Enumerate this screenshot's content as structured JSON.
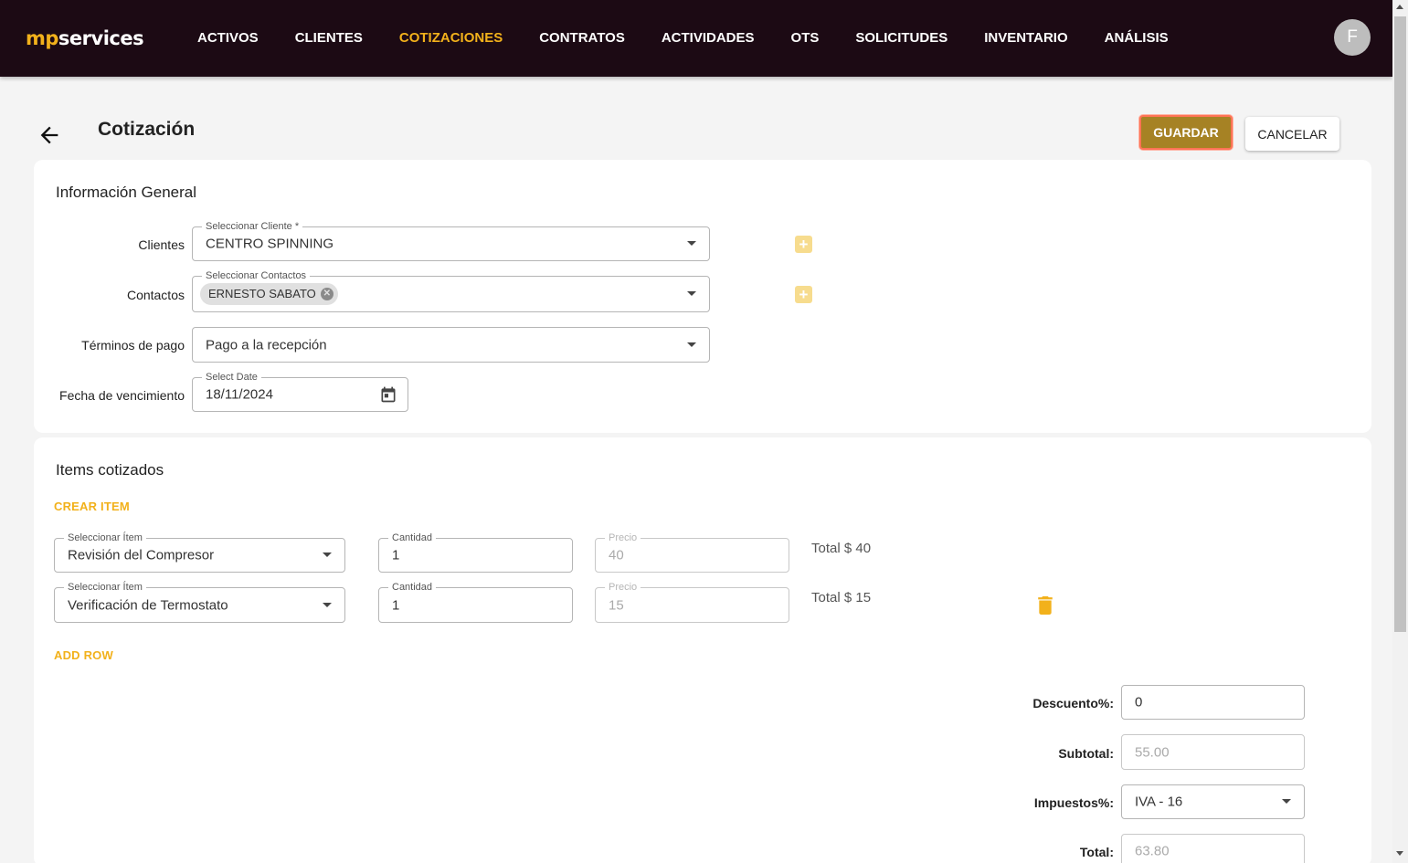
{
  "brand": {
    "logo_prefix": "mp",
    "logo_suffix": "services",
    "accent": "#f2b11b",
    "nav_bg": "#1c0a14"
  },
  "nav": {
    "items": [
      "ACTIVOS",
      "CLIENTES",
      "COTIZACIONES",
      "CONTRATOS",
      "ACTIVIDADES",
      "OTS",
      "SOLICITUDES",
      "INVENTARIO",
      "ANÁLISIS"
    ],
    "active": "COTIZACIONES",
    "avatar_initial": "F"
  },
  "header": {
    "title": "Cotización",
    "save_label": "GUARDAR",
    "cancel_label": "CANCELAR"
  },
  "general": {
    "title": "Información General",
    "clientes": {
      "label": "Clientes",
      "field_label": "Seleccionar Cliente *",
      "value": "CENTRO SPINNING"
    },
    "contactos": {
      "label": "Contactos",
      "field_label": "Seleccionar Contactos",
      "chip": "ERNESTO SABATO"
    },
    "terminos": {
      "label": "Términos de pago",
      "value": "Pago a la recepción"
    },
    "fecha": {
      "label": "Fecha de vencimiento",
      "field_label": "Select Date",
      "value": "18/11/2024"
    }
  },
  "items": {
    "title": "Items cotizados",
    "create_label": "CREAR ITEM",
    "add_row_label": "ADD ROW",
    "item_field_label": "Seleccionar Ítem",
    "qty_field_label": "Cantidad",
    "price_field_label": "Precio",
    "rows": [
      {
        "item": "Revisión del Compresor",
        "qty": "1",
        "price": "40",
        "total": "Total $ 40"
      },
      {
        "item": "Verificación de Termostato",
        "qty": "1",
        "price": "15",
        "total": "Total $ 15"
      }
    ]
  },
  "summary": {
    "descuento": {
      "label": "Descuento%:",
      "value": "0"
    },
    "subtotal": {
      "label": "Subtotal:",
      "value": "55.00"
    },
    "impuestos": {
      "label": "Impuestos%:",
      "value": "IVA - 16"
    },
    "total": {
      "label": "Total:",
      "value": "63.80"
    }
  }
}
